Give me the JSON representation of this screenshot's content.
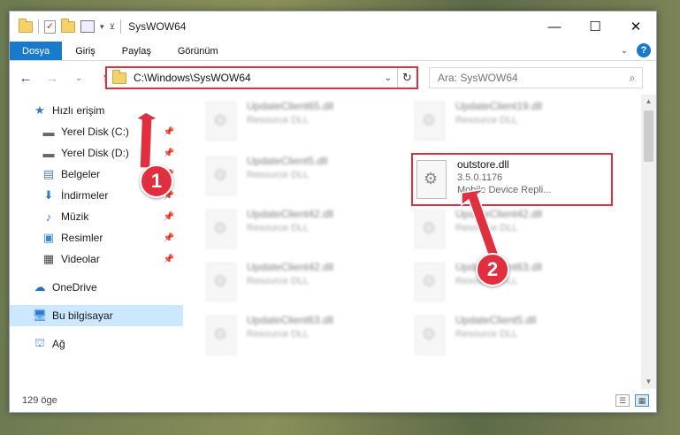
{
  "window": {
    "title": "SysWOW64"
  },
  "ribbon": {
    "tabs": [
      "Dosya",
      "Giriş",
      "Paylaş",
      "Görünüm"
    ],
    "help": "?"
  },
  "address": {
    "path": "C:\\Windows\\SysWOW64"
  },
  "search": {
    "placeholder": "Ara: SysWOW64"
  },
  "sidebar": {
    "quick_access": "Hızlı erişim",
    "items": [
      {
        "label": "Yerel Disk (C:)",
        "icon": "drive-icon",
        "pinned": true
      },
      {
        "label": "Yerel Disk (D:)",
        "icon": "drive-icon",
        "pinned": true
      },
      {
        "label": "Belgeler",
        "icon": "documents-icon",
        "pinned": true
      },
      {
        "label": "İndirmeler",
        "icon": "download-icon",
        "pinned": true
      },
      {
        "label": "Müzik",
        "icon": "music-icon",
        "pinned": true
      },
      {
        "label": "Resimler",
        "icon": "pictures-icon",
        "pinned": true
      },
      {
        "label": "Videolar",
        "icon": "video-icon",
        "pinned": true
      }
    ],
    "onedrive": "OneDrive",
    "this_pc": "Bu bilgisayar",
    "network": "Ağ"
  },
  "files": [
    {
      "name": "UpdateClient65.dll",
      "sub": "Resource DLL"
    },
    {
      "name": "UpdateClient19.dll",
      "sub": "Resource DLL"
    },
    {
      "name": "UpdateClient5.dll",
      "sub": "Resource DLL"
    },
    {
      "name": "outstore.dll",
      "version": "3.5.0.1176",
      "desc": "Mobile Device Repli..."
    },
    {
      "name": "UpdateClient42.dll",
      "sub": "Resource DLL"
    },
    {
      "name": "UpdateClient42.dll",
      "sub": "Resource DLL"
    },
    {
      "name": "UpdateClient42.dll",
      "sub": "Resource DLL"
    },
    {
      "name": "UpdateClient63.dll",
      "sub": "Resource DLL"
    },
    {
      "name": "UpdateClient63.dll",
      "sub": "Resource DLL"
    },
    {
      "name": "UpdateClient5.dll",
      "sub": "Resource DLL"
    }
  ],
  "status": {
    "count": "129 öge"
  },
  "annotations": {
    "step1": "1",
    "step2": "2",
    "color": "#e03040"
  }
}
